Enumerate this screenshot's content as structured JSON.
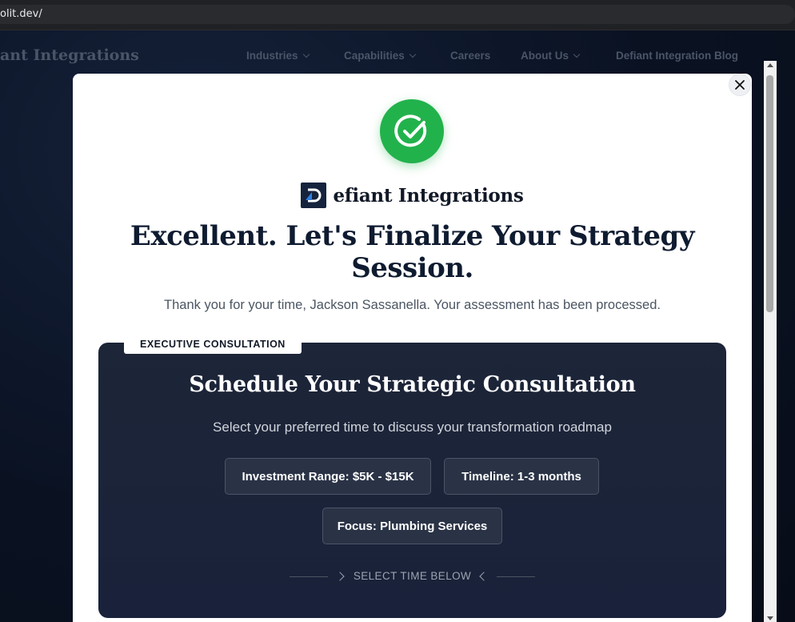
{
  "browser": {
    "url": "olit.dev/"
  },
  "site": {
    "brand": "ant Integrations",
    "nav": [
      {
        "label": "Industries",
        "dropdown": true
      },
      {
        "label": "Capabilities",
        "dropdown": true
      },
      {
        "label": "Careers",
        "dropdown": false
      },
      {
        "label": "About Us",
        "dropdown": true
      },
      {
        "label": "Defiant Integration Blog",
        "dropdown": false
      }
    ]
  },
  "modal": {
    "close_icon": "close-icon",
    "success_icon": "check-circle-icon",
    "logo_text": "efiant Integrations",
    "title": "Excellent. Let's Finalize Your Strategy Session.",
    "thanks": "Thank you for your time, Jackson Sassanella. Your assessment has been processed.",
    "card": {
      "badge": "EXECUTIVE CONSULTATION",
      "title": "Schedule Your Strategic Consultation",
      "subtitle": "Select your preferred time to discuss your transformation roadmap",
      "pills": [
        "Investment Range: $5K - $15K",
        "Timeline: 1-3 months",
        "Focus: Plumbing Services"
      ],
      "divider_label": "SELECT TIME BELOW"
    }
  },
  "colors": {
    "success": "#22b24c",
    "card_bg": "#1d2538",
    "heading": "#0f1b30"
  }
}
